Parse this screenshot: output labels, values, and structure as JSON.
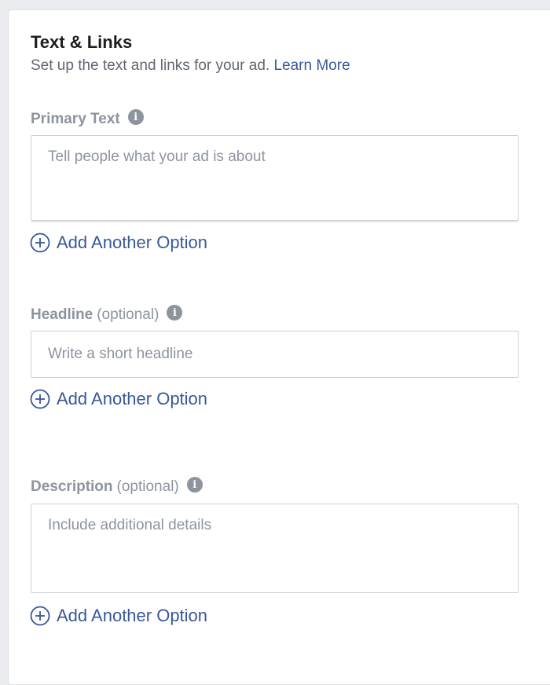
{
  "section": {
    "title": "Text & Links",
    "subtitle": "Set up the text and links for your ad.",
    "learn_more": "Learn More"
  },
  "primary_text": {
    "label": "Primary Text",
    "placeholder": "Tell people what your ad is about",
    "add_option": "Add Another Option"
  },
  "headline": {
    "label": "Headline",
    "optional": "(optional)",
    "placeholder": "Write a short headline",
    "add_option": "Add Another Option"
  },
  "description": {
    "label": "Description",
    "optional": "(optional)",
    "placeholder": "Include additional details",
    "add_option": "Add Another Option"
  },
  "icons": {
    "info": "info-icon",
    "add": "plus-circle-icon"
  },
  "colors": {
    "link": "#385898",
    "label": "#8d949e",
    "title": "#1c1e21",
    "border": "#ccd0d5"
  }
}
